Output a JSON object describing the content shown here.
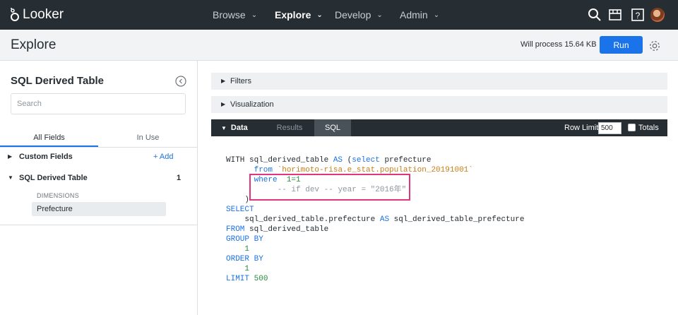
{
  "app": {
    "logo_text": "Looker"
  },
  "nav": {
    "items": [
      {
        "label": "Browse",
        "active": false
      },
      {
        "label": "Explore",
        "active": true
      },
      {
        "label": "Develop",
        "active": false
      },
      {
        "label": "Admin",
        "active": false
      }
    ],
    "icons": [
      "search-icon",
      "marketplace-icon",
      "help-icon",
      "avatar"
    ]
  },
  "header": {
    "title": "Explore",
    "process_text": "Will process 15.64 KB",
    "run_label": "Run"
  },
  "sidebar": {
    "title": "SQL Derived Table",
    "search_placeholder": "Search",
    "tabs": [
      "All Fields",
      "In Use"
    ],
    "custom_fields_label": "Custom Fields",
    "add_label": "+ Add",
    "view_label": "SQL Derived Table",
    "view_count": "1",
    "dimensions_header": "DIMENSIONS",
    "field_label": "Prefecture"
  },
  "panels": {
    "filters_label": "Filters",
    "visualization_label": "Visualization"
  },
  "data_bar": {
    "tabs": [
      "Data",
      "Results",
      "SQL"
    ],
    "active_tab": "SQL",
    "row_limit_label": "Row Limit",
    "row_limit_value": "500",
    "totals_label": "Totals"
  },
  "sql": {
    "l1_a": "WITH sql_derived_table ",
    "l1_kw": "AS",
    "l1_b": " (",
    "l1_kw2": "select",
    "l1_c": " prefecture",
    "l2_kw": "from",
    "l2_str": "`horimoto-risa.e_stat.population_20191001`",
    "l3_kw": "where",
    "l3_num": "1=1",
    "l4_cmt": "-- if dev -- year = \"2016年\"",
    "l5": ")",
    "l6_kw": "SELECT",
    "l7_a": "sql_derived_table.prefecture ",
    "l7_kw": "AS",
    "l7_b": " sql_derived_table_prefecture",
    "l8_kw": "FROM",
    "l8_b": " sql_derived_table",
    "l9_kw": "GROUP BY",
    "l10_num": "1",
    "l11_kw": "ORDER BY",
    "l12_num": "1",
    "l13_kw": "LIMIT",
    "l13_num": "500"
  },
  "colors": {
    "topbar": "#262d33",
    "accent": "#1a73e8",
    "highlight": "#e2357e"
  }
}
